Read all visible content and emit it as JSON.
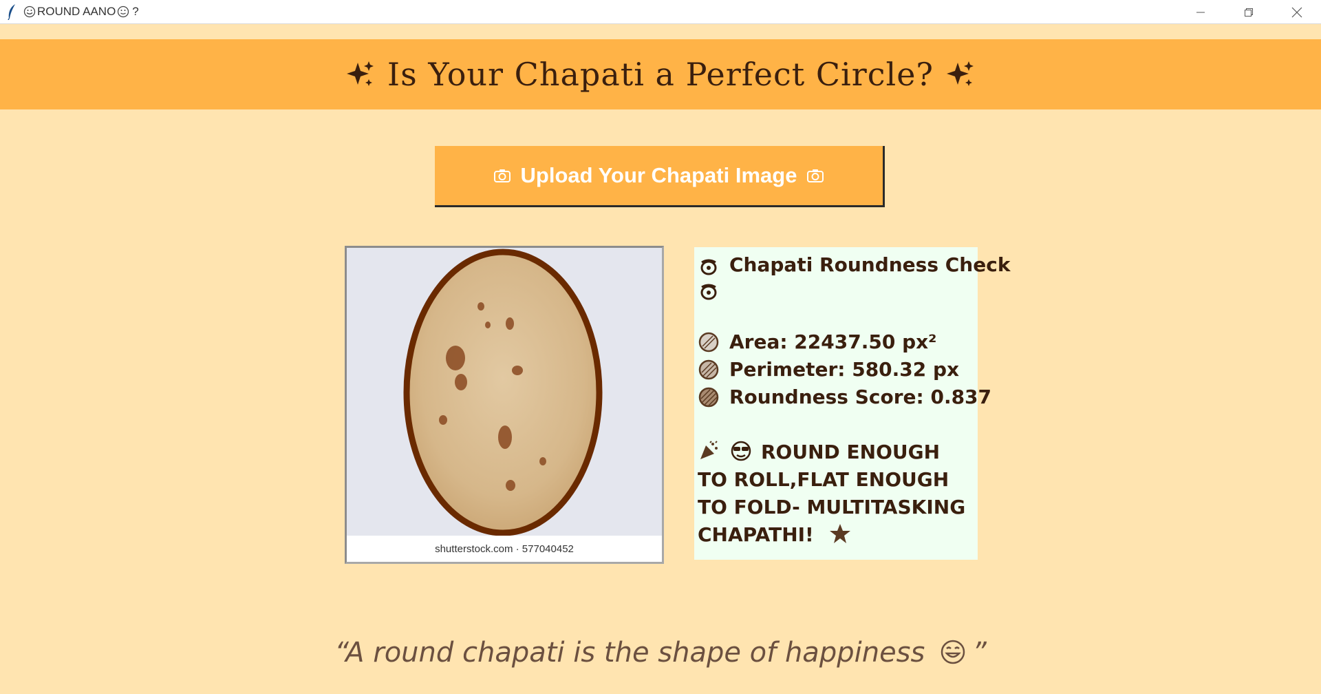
{
  "window": {
    "title": "ROUND AANO",
    "title_suffix": "?",
    "minimize_label": "—",
    "maximize_label": "❐",
    "close_label": "✕"
  },
  "header": {
    "title": "Is Your Chapati a Perfect Circle?"
  },
  "upload": {
    "label": "Upload Your Chapati Image"
  },
  "image_panel": {
    "caption": "shutterstock.com · 577040452"
  },
  "results": {
    "title": "Chapati Roundness Check",
    "area": "Area: 22437.50 px²",
    "perimeter": "Perimeter: 580.32 px",
    "roundness": "Roundness Score: 0.837",
    "verdict": "ROUND ENOUGH TO ROLL,FLAT ENOUGH TO FOLD- MULTITASKING CHAPATHI!"
  },
  "quote": {
    "text": "“A round chapati is the shape of happiness",
    "close": "”"
  },
  "colors": {
    "background": "#ffe4b0",
    "banner": "#ffb347",
    "result_panel": "#f0fff2",
    "text_brown": "#3a1f0e",
    "outline_brown": "#6a2a00"
  },
  "icons": [
    "feather-icon",
    "sparkles-icon",
    "camera-icon",
    "paw-icon",
    "circle-icon",
    "party-icon",
    "cool-face-icon",
    "star-icon",
    "grinning-face-icon"
  ]
}
